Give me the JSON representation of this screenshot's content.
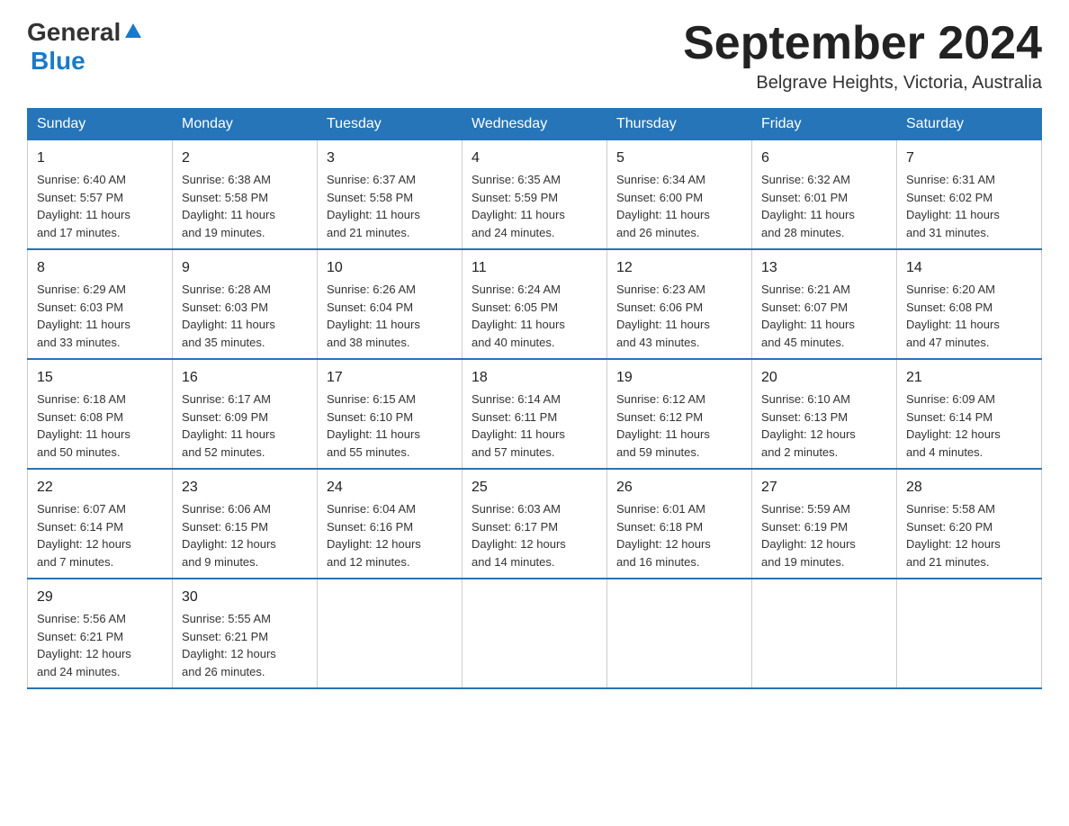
{
  "header": {
    "logo_general": "General",
    "logo_blue": "Blue",
    "title": "September 2024",
    "subtitle": "Belgrave Heights, Victoria, Australia"
  },
  "weekdays": [
    "Sunday",
    "Monday",
    "Tuesday",
    "Wednesday",
    "Thursday",
    "Friday",
    "Saturday"
  ],
  "weeks": [
    [
      {
        "day": "1",
        "sunrise": "6:40 AM",
        "sunset": "5:57 PM",
        "daylight": "11 hours and 17 minutes."
      },
      {
        "day": "2",
        "sunrise": "6:38 AM",
        "sunset": "5:58 PM",
        "daylight": "11 hours and 19 minutes."
      },
      {
        "day": "3",
        "sunrise": "6:37 AM",
        "sunset": "5:58 PM",
        "daylight": "11 hours and 21 minutes."
      },
      {
        "day": "4",
        "sunrise": "6:35 AM",
        "sunset": "5:59 PM",
        "daylight": "11 hours and 24 minutes."
      },
      {
        "day": "5",
        "sunrise": "6:34 AM",
        "sunset": "6:00 PM",
        "daylight": "11 hours and 26 minutes."
      },
      {
        "day": "6",
        "sunrise": "6:32 AM",
        "sunset": "6:01 PM",
        "daylight": "11 hours and 28 minutes."
      },
      {
        "day": "7",
        "sunrise": "6:31 AM",
        "sunset": "6:02 PM",
        "daylight": "11 hours and 31 minutes."
      }
    ],
    [
      {
        "day": "8",
        "sunrise": "6:29 AM",
        "sunset": "6:03 PM",
        "daylight": "11 hours and 33 minutes."
      },
      {
        "day": "9",
        "sunrise": "6:28 AM",
        "sunset": "6:03 PM",
        "daylight": "11 hours and 35 minutes."
      },
      {
        "day": "10",
        "sunrise": "6:26 AM",
        "sunset": "6:04 PM",
        "daylight": "11 hours and 38 minutes."
      },
      {
        "day": "11",
        "sunrise": "6:24 AM",
        "sunset": "6:05 PM",
        "daylight": "11 hours and 40 minutes."
      },
      {
        "day": "12",
        "sunrise": "6:23 AM",
        "sunset": "6:06 PM",
        "daylight": "11 hours and 43 minutes."
      },
      {
        "day": "13",
        "sunrise": "6:21 AM",
        "sunset": "6:07 PM",
        "daylight": "11 hours and 45 minutes."
      },
      {
        "day": "14",
        "sunrise": "6:20 AM",
        "sunset": "6:08 PM",
        "daylight": "11 hours and 47 minutes."
      }
    ],
    [
      {
        "day": "15",
        "sunrise": "6:18 AM",
        "sunset": "6:08 PM",
        "daylight": "11 hours and 50 minutes."
      },
      {
        "day": "16",
        "sunrise": "6:17 AM",
        "sunset": "6:09 PM",
        "daylight": "11 hours and 52 minutes."
      },
      {
        "day": "17",
        "sunrise": "6:15 AM",
        "sunset": "6:10 PM",
        "daylight": "11 hours and 55 minutes."
      },
      {
        "day": "18",
        "sunrise": "6:14 AM",
        "sunset": "6:11 PM",
        "daylight": "11 hours and 57 minutes."
      },
      {
        "day": "19",
        "sunrise": "6:12 AM",
        "sunset": "6:12 PM",
        "daylight": "11 hours and 59 minutes."
      },
      {
        "day": "20",
        "sunrise": "6:10 AM",
        "sunset": "6:13 PM",
        "daylight": "12 hours and 2 minutes."
      },
      {
        "day": "21",
        "sunrise": "6:09 AM",
        "sunset": "6:14 PM",
        "daylight": "12 hours and 4 minutes."
      }
    ],
    [
      {
        "day": "22",
        "sunrise": "6:07 AM",
        "sunset": "6:14 PM",
        "daylight": "12 hours and 7 minutes."
      },
      {
        "day": "23",
        "sunrise": "6:06 AM",
        "sunset": "6:15 PM",
        "daylight": "12 hours and 9 minutes."
      },
      {
        "day": "24",
        "sunrise": "6:04 AM",
        "sunset": "6:16 PM",
        "daylight": "12 hours and 12 minutes."
      },
      {
        "day": "25",
        "sunrise": "6:03 AM",
        "sunset": "6:17 PM",
        "daylight": "12 hours and 14 minutes."
      },
      {
        "day": "26",
        "sunrise": "6:01 AM",
        "sunset": "6:18 PM",
        "daylight": "12 hours and 16 minutes."
      },
      {
        "day": "27",
        "sunrise": "5:59 AM",
        "sunset": "6:19 PM",
        "daylight": "12 hours and 19 minutes."
      },
      {
        "day": "28",
        "sunrise": "5:58 AM",
        "sunset": "6:20 PM",
        "daylight": "12 hours and 21 minutes."
      }
    ],
    [
      {
        "day": "29",
        "sunrise": "5:56 AM",
        "sunset": "6:21 PM",
        "daylight": "12 hours and 24 minutes."
      },
      {
        "day": "30",
        "sunrise": "5:55 AM",
        "sunset": "6:21 PM",
        "daylight": "12 hours and 26 minutes."
      },
      null,
      null,
      null,
      null,
      null
    ]
  ],
  "labels": {
    "sunrise": "Sunrise:",
    "sunset": "Sunset:",
    "daylight": "Daylight:"
  }
}
